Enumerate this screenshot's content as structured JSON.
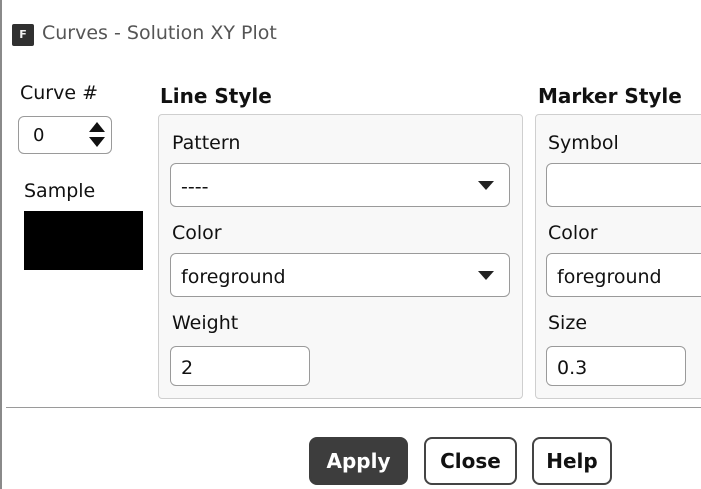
{
  "window": {
    "icon": "F",
    "title": "Curves - Solution XY Plot"
  },
  "curve": {
    "label": "Curve #",
    "value": "0",
    "sample_label": "Sample",
    "sample_color": "#000000"
  },
  "line_style": {
    "title": "Line Style",
    "pattern_label": "Pattern",
    "pattern_value": "----",
    "color_label": "Color",
    "color_value": "foreground",
    "weight_label": "Weight",
    "weight_value": "2"
  },
  "marker_style": {
    "title": "Marker Style",
    "symbol_label": "Symbol",
    "symbol_value": "",
    "color_label": "Color",
    "color_value": "foreground",
    "size_label": "Size",
    "size_value": "0.3"
  },
  "buttons": {
    "apply": "Apply",
    "close": "Close",
    "help": "Help"
  }
}
